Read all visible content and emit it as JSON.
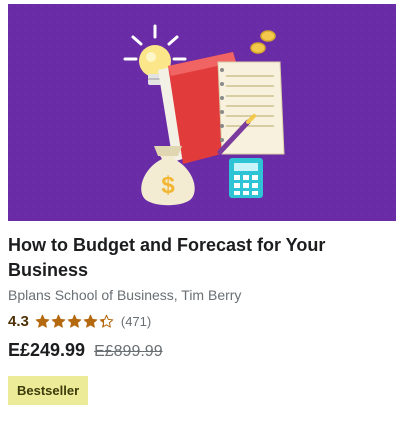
{
  "course": {
    "title": "How to Budget and Forecast for Your Business",
    "authors": "Bplans School of Business, Tim Berry",
    "rating": 4.3,
    "rating_label": "4.3",
    "rating_count": "(471)",
    "price": "E£249.99",
    "original_price": "E£899.99",
    "badge": "Bestseller"
  },
  "colors": {
    "thumbnail_bg": "#6a2ca6",
    "star": "#b4690e",
    "badge_bg": "#eceb98"
  },
  "icons": [
    "lightbulb-icon",
    "notebook-icon",
    "money-bag-icon",
    "calculator-icon",
    "pen-icon",
    "coin-icon",
    "star-icon"
  ]
}
